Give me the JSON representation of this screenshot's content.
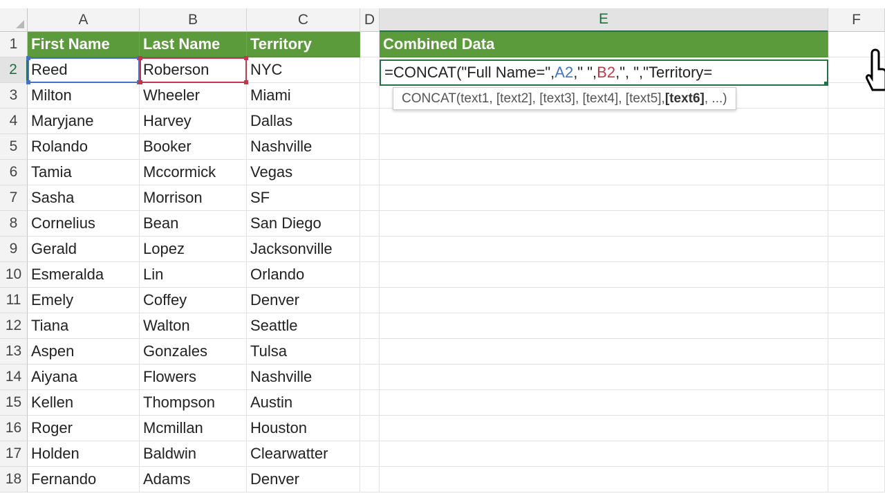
{
  "columns": [
    "A",
    "B",
    "C",
    "D",
    "E",
    "F"
  ],
  "rows": [
    "1",
    "2",
    "3",
    "4",
    "5",
    "6",
    "7",
    "8",
    "9",
    "10",
    "11",
    "12",
    "13",
    "14",
    "15",
    "16",
    "17",
    "18"
  ],
  "headers": {
    "a": "First Name",
    "b": "Last Name",
    "c": "Territory",
    "e": "Combined Data"
  },
  "data": [
    {
      "first": "Reed",
      "last": "Roberson",
      "territory": "NYC"
    },
    {
      "first": "Milton",
      "last": "Wheeler",
      "territory": "Miami"
    },
    {
      "first": "Maryjane",
      "last": "Harvey",
      "territory": "Dallas"
    },
    {
      "first": "Rolando",
      "last": "Booker",
      "territory": "Nashville"
    },
    {
      "first": "Tamia",
      "last": "Mccormick",
      "territory": "Vegas"
    },
    {
      "first": "Sasha",
      "last": "Morrison",
      "territory": "SF"
    },
    {
      "first": "Cornelius",
      "last": "Bean",
      "territory": "San Diego"
    },
    {
      "first": "Gerald",
      "last": "Lopez",
      "territory": "Jacksonville"
    },
    {
      "first": "Esmeralda",
      "last": "Lin",
      "territory": "Orlando"
    },
    {
      "first": "Emely",
      "last": "Coffey",
      "territory": "Denver"
    },
    {
      "first": "Tiana",
      "last": "Walton",
      "territory": "Seattle"
    },
    {
      "first": "Aspen",
      "last": "Gonzales",
      "territory": "Tulsa"
    },
    {
      "first": "Aiyana",
      "last": "Flowers",
      "territory": "Nashville"
    },
    {
      "first": "Kellen",
      "last": "Thompson",
      "territory": "Austin"
    },
    {
      "first": "Roger",
      "last": "Mcmillan",
      "territory": "Houston"
    },
    {
      "first": "Holden",
      "last": "Baldwin",
      "territory": "Clearwatter"
    },
    {
      "first": "Fernando",
      "last": "Adams",
      "territory": "Denver"
    }
  ],
  "formula": {
    "p1": "=CONCAT(\"Full Name=\",",
    "ref1": "A2",
    "p2": ",\" \",",
    "ref2": "B2",
    "p3": ",\", \",\"Territory=",
    "tooltip_text": "CONCAT(text1, [text2], [text3], [text4], [text5], ",
    "tooltip_bold": "[text6]",
    "tooltip_end": ", ...)"
  },
  "colors": {
    "header_fill": "#5b9b3b",
    "ref_a": "#4472c4",
    "ref_b": "#c0394b",
    "selection": "#217346"
  },
  "icons": {
    "cursor": "hand-pointer-icon"
  }
}
